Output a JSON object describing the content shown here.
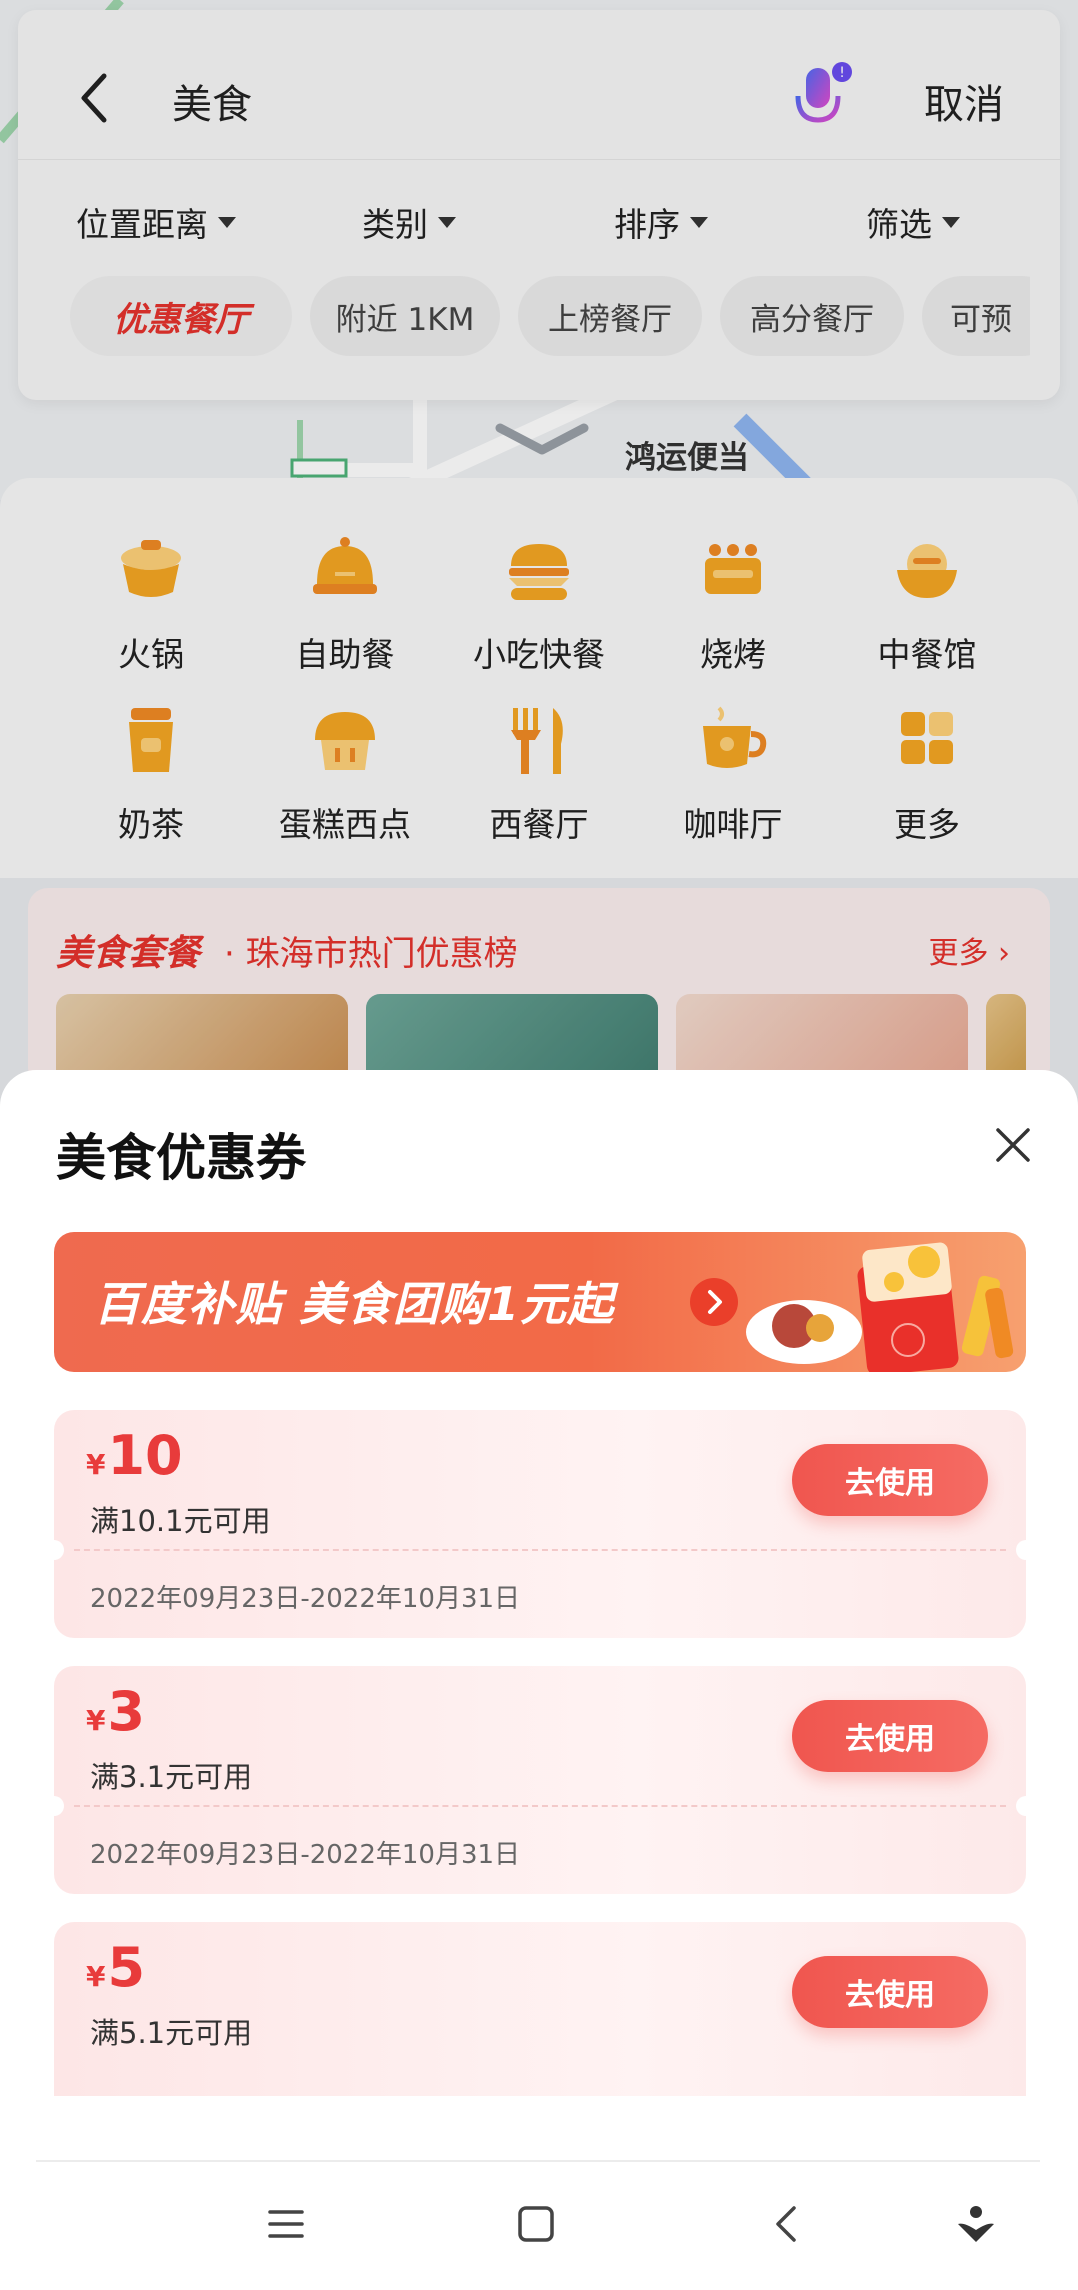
{
  "search": {
    "query": "美食",
    "cancel_label": "取消"
  },
  "filters": [
    "位置距离",
    "类别",
    "排序",
    "筛选"
  ],
  "chips": [
    "优惠餐厅",
    "附近 1KM",
    "上榜餐厅",
    "高分餐厅",
    "可预"
  ],
  "map": {
    "poi_label": "鸿运便当"
  },
  "categories": [
    {
      "label": "火锅",
      "icon": "hotpot-icon"
    },
    {
      "label": "自助餐",
      "icon": "buffet-icon"
    },
    {
      "label": "小吃快餐",
      "icon": "burger-icon"
    },
    {
      "label": "烧烤",
      "icon": "bbq-icon"
    },
    {
      "label": "中餐馆",
      "icon": "rice-bowl-icon"
    },
    {
      "label": "奶茶",
      "icon": "milk-tea-icon"
    },
    {
      "label": "蛋糕西点",
      "icon": "cake-icon"
    },
    {
      "label": "西餐厅",
      "icon": "fork-knife-icon"
    },
    {
      "label": "咖啡厅",
      "icon": "coffee-icon"
    },
    {
      "label": "更多",
      "icon": "grid-icon"
    }
  ],
  "deals": {
    "title": "美食套餐",
    "subtitle": "· 珠海市热门优惠榜",
    "more_label": "更多"
  },
  "sheet": {
    "title": "美食优惠券",
    "banner_text": "百度补贴 美食团购1元起",
    "coupons": [
      {
        "currency": "¥",
        "amount": "10",
        "condition": "满10.1元可用",
        "validity": "2022年09月23日-2022年10月31日",
        "button": "去使用"
      },
      {
        "currency": "¥",
        "amount": "3",
        "condition": "满3.1元可用",
        "validity": "2022年09月23日-2022年10月31日",
        "button": "去使用"
      },
      {
        "currency": "¥",
        "amount": "5",
        "condition": "满5.1元可用",
        "validity": "",
        "button": "去使用"
      }
    ]
  },
  "colors": {
    "accent": "#e83b3b",
    "button": "#f0564f",
    "category_icon": "#f5a623"
  }
}
